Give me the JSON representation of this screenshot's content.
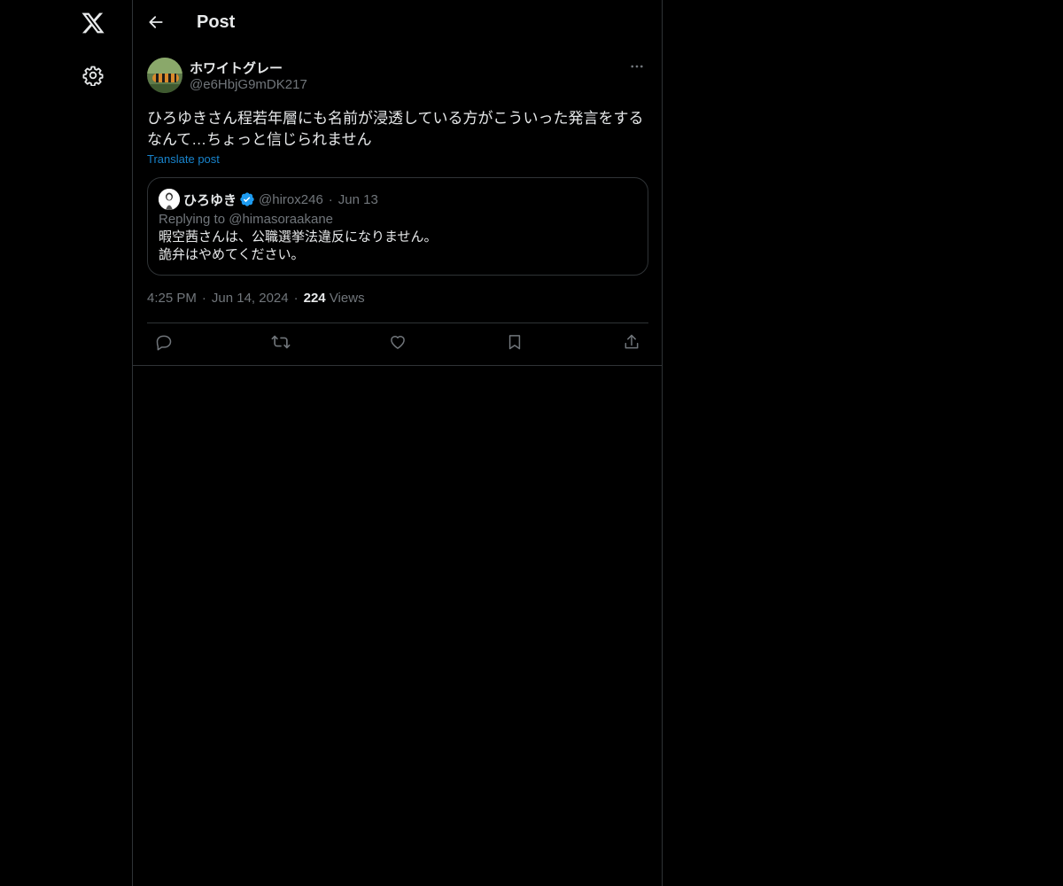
{
  "header": {
    "title": "Post"
  },
  "nav": {
    "logo_icon": "x-logo-icon",
    "settings_icon": "gear-icon"
  },
  "post": {
    "author_name": "ホワイトグレー",
    "author_handle": "@e6HbjG9mDK217",
    "text": "ひろゆきさん程若年層にも名前が浸透している方がこういった発言をするなんて…ちょっと信じられません",
    "translate_label": "Translate post",
    "time": "4:25 PM",
    "date": "Jun 14, 2024",
    "views_count": "224",
    "views_label": "Views"
  },
  "quote": {
    "author_name": "ひろゆき",
    "author_handle": "@hirox246",
    "date": "Jun 13",
    "replying_to": "Replying to @himasoraakane",
    "body_line1": "暇空茜さんは、公職選挙法違反になりません。",
    "body_line2": "詭弁はやめてください。"
  },
  "actions": {
    "reply_icon": "reply-icon",
    "repost_icon": "repost-icon",
    "like_icon": "heart-icon",
    "bookmark_icon": "bookmark-icon",
    "share_icon": "share-icon"
  },
  "colors": {
    "background": "#000000",
    "border": "#2f3336",
    "text_primary": "#e7e9ea",
    "text_secondary": "#71767b",
    "accent": "#1d9bf0"
  }
}
